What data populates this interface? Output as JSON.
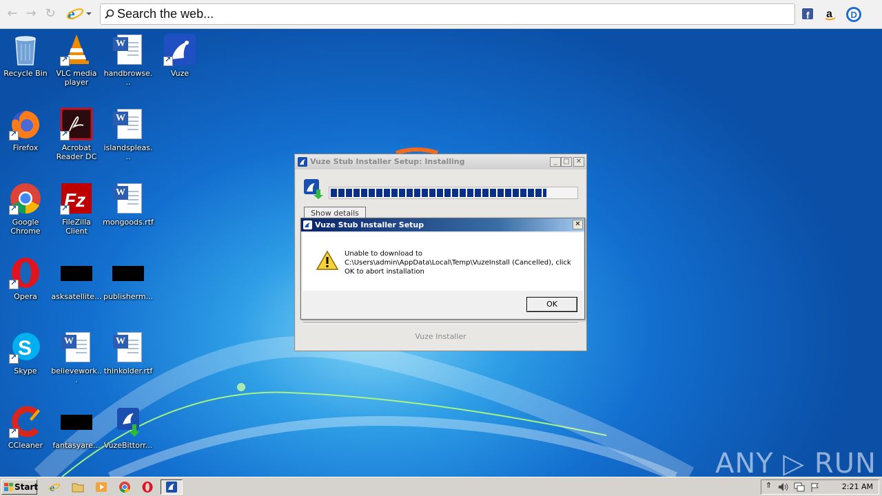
{
  "browser": {
    "search_placeholder": "Search the web...",
    "icons": [
      "back-arrow-icon",
      "forward-arrow-icon",
      "refresh-icon",
      "internet-explorer-icon",
      "search-icon",
      "facebook-icon",
      "amazon-icon",
      "duckduckgo-icon"
    ]
  },
  "desktop": {
    "icons": [
      {
        "label": "Recycle Bin",
        "icon": "recycle-bin-icon"
      },
      {
        "label": "VLC media player",
        "icon": "vlc-icon"
      },
      {
        "label": "handbrowse...",
        "icon": "word-doc-icon"
      },
      {
        "label": "Vuze",
        "icon": "vuze-icon"
      },
      {
        "label": "Firefox",
        "icon": "firefox-icon"
      },
      {
        "label": "Acrobat Reader DC",
        "icon": "acrobat-icon"
      },
      {
        "label": "islandspleas...",
        "icon": "word-doc-icon"
      },
      {
        "label": "Google Chrome",
        "icon": "chrome-icon"
      },
      {
        "label": "FileZilla Client",
        "icon": "filezilla-icon"
      },
      {
        "label": "mongoods.rtf",
        "icon": "word-doc-icon"
      },
      {
        "label": "Opera",
        "icon": "opera-icon"
      },
      {
        "label": "asksatellite...",
        "icon": "black-file-icon"
      },
      {
        "label": "publisherm...",
        "icon": "black-file-icon"
      },
      {
        "label": "Skype",
        "icon": "skype-icon"
      },
      {
        "label": "believework...",
        "icon": "word-doc-icon"
      },
      {
        "label": "thinkolder.rtf",
        "icon": "word-doc-icon"
      },
      {
        "label": "CCleaner",
        "icon": "ccleaner-icon"
      },
      {
        "label": "fantasyare...",
        "icon": "black-file-icon"
      },
      {
        "label": "VuzeBittorr...",
        "icon": "vuze-installer-icon"
      }
    ]
  },
  "installer": {
    "title": "Vuze Stub Installer Setup: Installing",
    "show_details_label": "Show details",
    "brand_text": "Vuze Installer",
    "progress_fraction": 0.88
  },
  "dialog": {
    "title": "Vuze Stub Installer Setup",
    "message_line1": "Unable to download to",
    "message_line2": "C:\\Users\\admin\\AppData\\Local\\Temp\\VuzeInstall (Cancelled), click",
    "message_line3": "OK to abort installation",
    "ok_label": "OK"
  },
  "taskbar": {
    "start_label": "Start",
    "clock": "2:21 AM"
  },
  "watermark": "ANY ▷ RUN",
  "colors": {
    "dialog_title": "#0a246a",
    "progress": "#0a2f86",
    "desktop": "#1565b8"
  }
}
